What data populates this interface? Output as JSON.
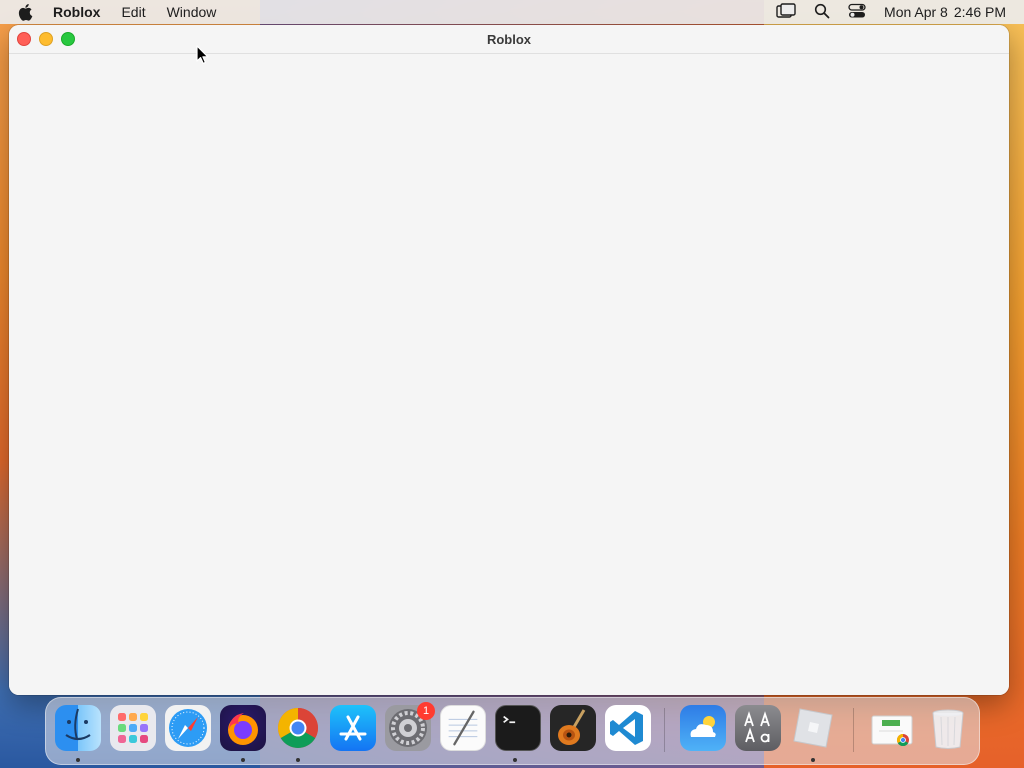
{
  "menubar": {
    "app_name": "Roblox",
    "items": [
      "Edit",
      "Window"
    ],
    "status_icons": [
      "screen-mirroring-icon",
      "spotlight-search-icon",
      "control-center-icon"
    ],
    "clock": {
      "date": "Mon Apr 8",
      "time": "2:46 PM"
    }
  },
  "window": {
    "title": "Roblox",
    "controls": [
      "close",
      "minimize",
      "zoom"
    ]
  },
  "dock": {
    "apps": [
      {
        "name": "Finder",
        "running": true
      },
      {
        "name": "Launchpad",
        "running": false
      },
      {
        "name": "Safari",
        "running": false
      },
      {
        "name": "Firefox",
        "running": true
      },
      {
        "name": "Google Chrome",
        "running": true
      },
      {
        "name": "App Store",
        "running": false
      },
      {
        "name": "System Settings",
        "running": false,
        "badge": "1"
      },
      {
        "name": "TextEdit",
        "running": false
      },
      {
        "name": "Terminal",
        "running": true
      },
      {
        "name": "GarageBand",
        "running": false
      },
      {
        "name": "Visual Studio Code",
        "running": false
      },
      {
        "name": "Weather",
        "running": false
      },
      {
        "name": "Font Book",
        "running": false
      },
      {
        "name": "Roblox",
        "running": true
      },
      {
        "name": "Chrome Downloads",
        "running": false
      },
      {
        "name": "Trash",
        "running": false
      }
    ]
  },
  "colors": {
    "close": "#ff5f57",
    "minimize": "#febc2e",
    "zoom": "#28c840",
    "badge": "#ff3b30"
  }
}
